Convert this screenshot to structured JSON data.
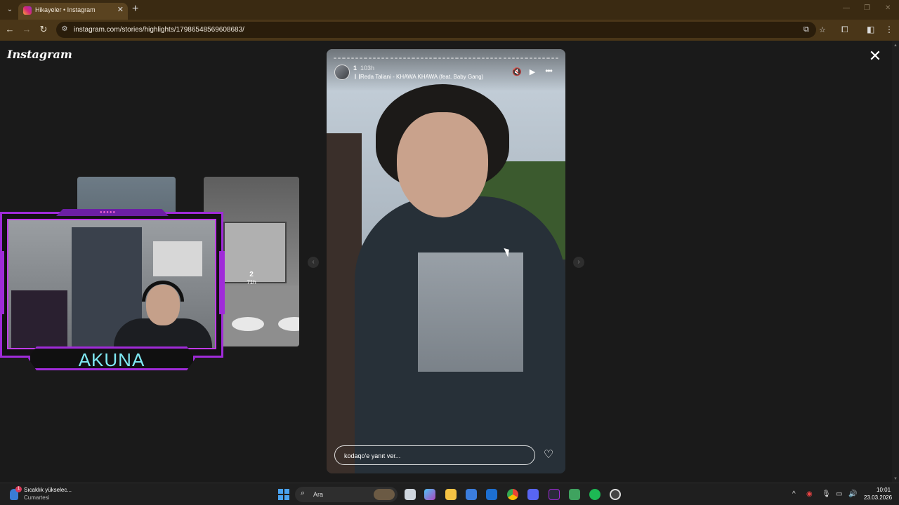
{
  "browser": {
    "tab_title": "Hikayeler • Instagram",
    "tab_close": "✕",
    "new_tab": "+",
    "url": "instagram.com/stories/highlights/17986548569608683/",
    "window_controls": [
      "—",
      "❐",
      "✕"
    ]
  },
  "instagram": {
    "logo": "Instagram",
    "close_label": "✕",
    "prev_arrow": "‹",
    "next_arrow": "›",
    "next_thumb": {
      "count": "2",
      "time": "71h"
    },
    "story": {
      "username": "1",
      "time": "103h",
      "music": "Reda Taliani - KHAWA KHAWA (feat. Baby Gang)",
      "reply_placeholder": "kodaqo'e yanıt ver...",
      "progress_segments": 52
    }
  },
  "stream_overlay": {
    "name": "AKUNA",
    "accent": "#a02bd9"
  },
  "taskbar": {
    "weather_title": "Sıcaklık yükselec...",
    "weather_sub": "Cumartesi",
    "weather_badge": "1",
    "search_label": "Ara",
    "time": "10:01",
    "date": "23.03.2026"
  },
  "colors": {
    "tab_bar": "#3a2a12",
    "toolbar": "#4a3618",
    "viewer_bg": "#1a1a1a",
    "taskbar": "#1f1f1f"
  }
}
